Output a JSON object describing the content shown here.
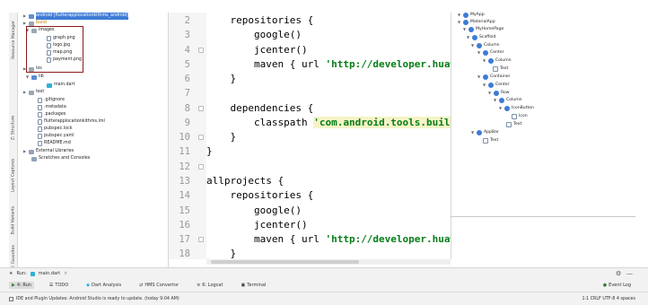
{
  "left_strip": {
    "tabs": [
      "Resource Manager",
      "1: Project",
      "Z: Structure",
      "Layout Captures",
      "Build Variants",
      "2: Favorites"
    ]
  },
  "project_tree": [
    {
      "label": "android [flutterapplocationkithms_android]",
      "icon": "folder-icon"
    },
    {
      "label": "build",
      "icon": "folder-icon"
    },
    {
      "label": "images",
      "icon": "folder-icon"
    },
    {
      "label": "graph.png",
      "icon": "image-file-icon"
    },
    {
      "label": "logo.jpg",
      "icon": "image-file-icon"
    },
    {
      "label": "map.png",
      "icon": "image-file-icon"
    },
    {
      "label": "payment.png",
      "icon": "image-file-icon"
    },
    {
      "label": "ios",
      "icon": "folder-icon"
    },
    {
      "label": "lib",
      "icon": "folder-icon"
    },
    {
      "label": "main.dart",
      "icon": "dart-file-icon"
    },
    {
      "label": "test",
      "icon": "folder-icon"
    },
    {
      "label": ".gitignore",
      "icon": "file-icon"
    },
    {
      "label": ".metadata",
      "icon": "file-icon"
    },
    {
      "label": ".packages",
      "icon": "file-icon"
    },
    {
      "label": "flutterapplocationkithms.iml",
      "icon": "file-icon"
    },
    {
      "label": "pubspec.lock",
      "icon": "file-icon"
    },
    {
      "label": "pubspec.yaml",
      "icon": "file-icon"
    },
    {
      "label": "README.md",
      "icon": "file-icon"
    },
    {
      "label": "External Libraries",
      "icon": "library-icon"
    },
    {
      "label": "Scratches and Consoles",
      "icon": "scratch-icon"
    }
  ],
  "editor": {
    "line_numbers": [
      "2",
      "3",
      "4",
      "5",
      "6",
      "7",
      "8",
      "9",
      "10",
      "11",
      "12",
      "13",
      "14",
      "15",
      "16",
      "17",
      "18"
    ],
    "lines": [
      {
        "plain": "    repositories {",
        "str": "",
        "tail": ""
      },
      {
        "plain": "        google()",
        "str": "",
        "tail": ""
      },
      {
        "plain": "        jcenter()",
        "str": "",
        "tail": ""
      },
      {
        "plain": "        maven { url ",
        "str": "'http://developer.huawei",
        "tail": ""
      },
      {
        "plain": "    }",
        "str": "",
        "tail": ""
      },
      {
        "plain": "",
        "str": "",
        "tail": ""
      },
      {
        "plain": "    dependencies {",
        "str": "",
        "tail": ""
      },
      {
        "plain": "        classpath ",
        "hl": "'com.android.tools.build:g",
        "tail": ""
      },
      {
        "plain": "    }",
        "str": "",
        "tail": ""
      },
      {
        "plain": "}",
        "str": "",
        "tail": ""
      },
      {
        "plain": "",
        "str": "",
        "tail": ""
      },
      {
        "plain": "allprojects {",
        "str": "",
        "tail": ""
      },
      {
        "plain": "    repositories {",
        "str": "",
        "tail": ""
      },
      {
        "plain": "        google()",
        "str": "",
        "tail": ""
      },
      {
        "plain": "        jcenter()",
        "str": "",
        "tail": ""
      },
      {
        "plain": "        maven { url ",
        "str": "'http://developer.huawei",
        "tail": ""
      },
      {
        "plain": "    }",
        "str": "",
        "tail": ""
      }
    ]
  },
  "widget_tree": [
    "MyApp",
    "MaterialApp",
    "MyHomePage",
    "Scaffold",
    "Column",
    "Center",
    "Column",
    "Text",
    "Container",
    "Center",
    "Row",
    "Column",
    "IconButton",
    "Icon",
    "Text",
    "AppBar",
    "Text"
  ],
  "run_bar": {
    "label": "Run:",
    "config": "main.dart"
  },
  "bottom_tabs": [
    "4: Run",
    "TODO",
    "Dart Analysis",
    "HMS Convertor",
    "6: Logcat",
    "Terminal"
  ],
  "event_log": "Event Log",
  "status": {
    "message": "IDE and Plugin Updates: Android Studio is ready to update. (today 9:04 AM)",
    "right": "1:1  CRLF  UTF-8  4 spaces"
  },
  "colors": {
    "accent": "#3d7bd6",
    "string": "#067d17",
    "highlight": "#f5f3c7",
    "redbox": "#8b1a1a"
  }
}
